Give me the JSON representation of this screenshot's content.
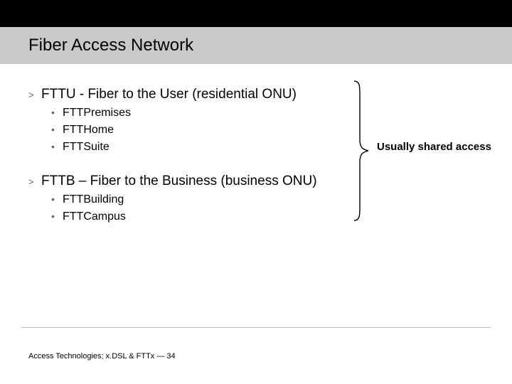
{
  "title": "Fiber Access Network",
  "b1": {
    "heading": "FTTU - Fiber to the User (residential ONU)",
    "items": [
      "FTTPremises",
      "FTTHome",
      "FTTSuite"
    ]
  },
  "b2": {
    "heading": "FTTB – Fiber to the Business (business ONU)",
    "items": [
      "FTTBuilding",
      "FTTCampus"
    ]
  },
  "annotation": "Usually shared access",
  "markers": {
    "lvl1": ">",
    "lvl2": "•"
  },
  "footer": "Access Technologies; x.DSL & FTTx — 34"
}
